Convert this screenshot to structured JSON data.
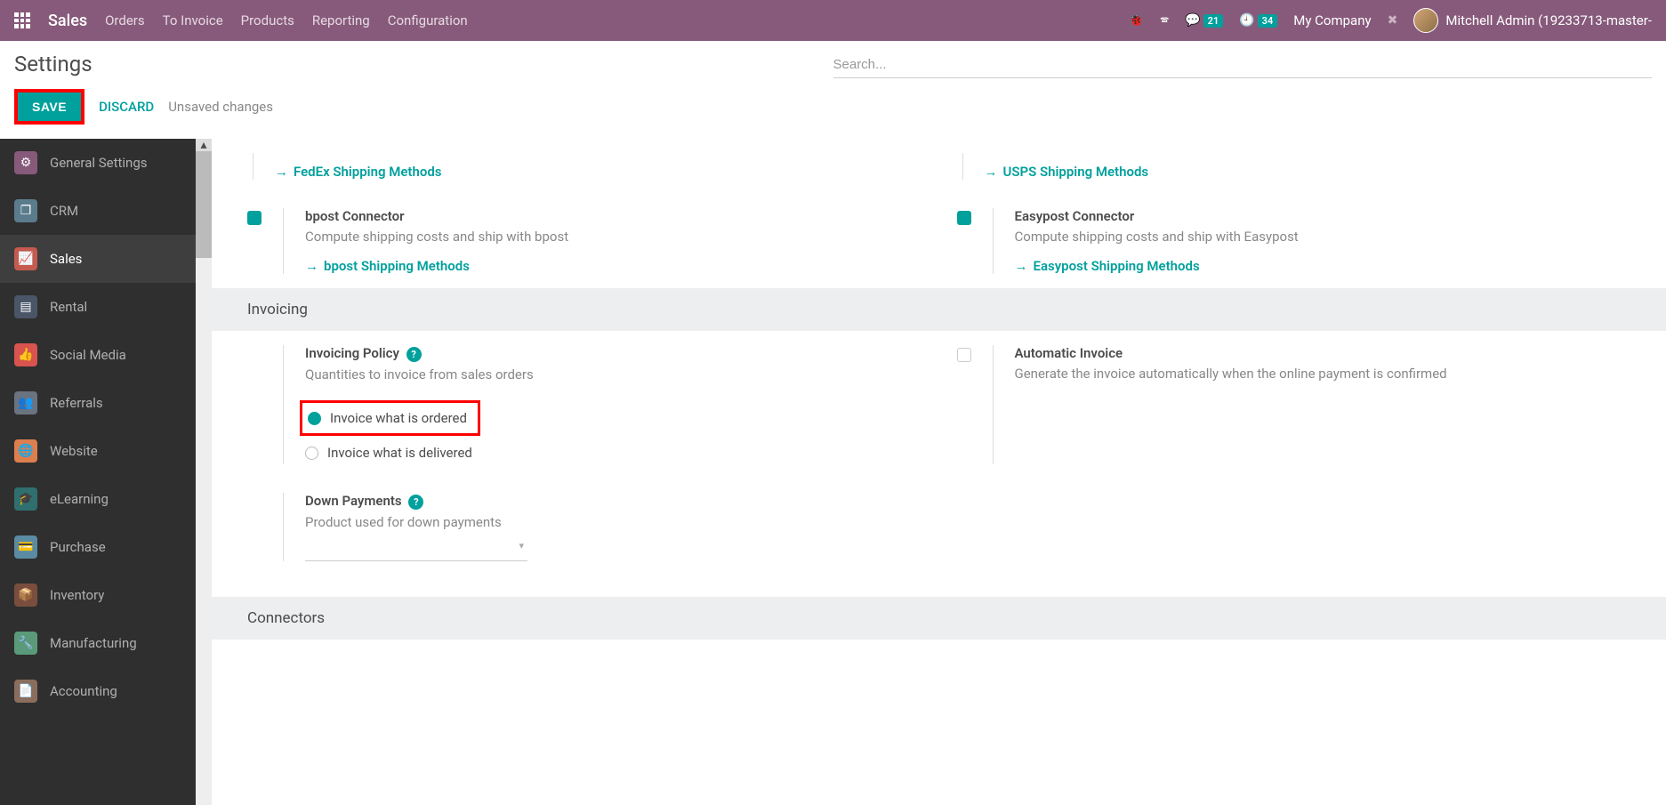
{
  "navbar": {
    "brand": "Sales",
    "links": [
      "Orders",
      "To Invoice",
      "Products",
      "Reporting",
      "Configuration"
    ],
    "msg_count": "21",
    "act_count": "34",
    "company": "My Company",
    "user": "Mitchell Admin (19233713-master-"
  },
  "page": {
    "title": "Settings",
    "search_placeholder": "Search...",
    "save": "SAVE",
    "discard": "DISCARD",
    "unsaved": "Unsaved changes"
  },
  "sidebar": [
    {
      "label": "General Settings",
      "cls": "bg-gear",
      "glyph": "⚙"
    },
    {
      "label": "CRM",
      "cls": "bg-crm",
      "glyph": "❐"
    },
    {
      "label": "Sales",
      "cls": "bg-sales",
      "glyph": "📈",
      "active": true
    },
    {
      "label": "Rental",
      "cls": "bg-rental",
      "glyph": "▤"
    },
    {
      "label": "Social Media",
      "cls": "bg-social",
      "glyph": "👍"
    },
    {
      "label": "Referrals",
      "cls": "bg-ref",
      "glyph": "👥"
    },
    {
      "label": "Website",
      "cls": "bg-web",
      "glyph": "🌐"
    },
    {
      "label": "eLearning",
      "cls": "bg-el",
      "glyph": "🎓"
    },
    {
      "label": "Purchase",
      "cls": "bg-pur",
      "glyph": "💳"
    },
    {
      "label": "Inventory",
      "cls": "bg-inv",
      "glyph": "📦"
    },
    {
      "label": "Manufacturing",
      "cls": "bg-man",
      "glyph": "🔧"
    },
    {
      "label": "Accounting",
      "cls": "bg-acc",
      "glyph": "📄"
    }
  ],
  "shipping": {
    "fedex_link": "FedEx Shipping Methods",
    "usps_link": "USPS Shipping Methods",
    "bpost_title": "bpost Connector",
    "bpost_desc": "Compute shipping costs and ship with bpost",
    "bpost_link": "bpost Shipping Methods",
    "easy_title": "Easypost Connector",
    "easy_desc": "Compute shipping costs and ship with Easypost",
    "easy_link": "Easypost Shipping Methods"
  },
  "invoicing": {
    "header": "Invoicing",
    "policy_title": "Invoicing Policy",
    "policy_desc": "Quantities to invoice from sales orders",
    "opt_ordered": "Invoice what is ordered",
    "opt_delivered": "Invoice what is delivered",
    "auto_title": "Automatic Invoice",
    "auto_desc": "Generate the invoice automatically when the online payment is confirmed",
    "down_title": "Down Payments",
    "down_desc": "Product used for down payments"
  },
  "connectors": {
    "header": "Connectors"
  }
}
